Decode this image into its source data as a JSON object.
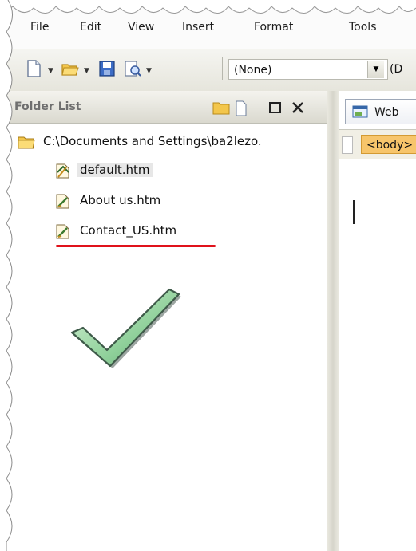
{
  "menu": {
    "items": [
      {
        "label": "File"
      },
      {
        "label": "Edit"
      },
      {
        "label": "View"
      },
      {
        "label": "Insert"
      },
      {
        "label": "Format"
      },
      {
        "label": "Tools"
      }
    ]
  },
  "toolbar": {
    "style_value": "(None)",
    "font_value": "(D"
  },
  "folder_list": {
    "title": "Folder List",
    "root_path": "C:\\Documents and Settings\\ba2lezo.",
    "files": [
      {
        "name": "default.htm",
        "selected": true
      },
      {
        "name": "About us.htm",
        "selected": false
      },
      {
        "name": "Contact_US.htm",
        "selected": false
      }
    ]
  },
  "editor": {
    "tab_label": "Web",
    "tag_label": "<body>"
  },
  "colors": {
    "underline": "#e0121b",
    "checkmark": "#9fd7a3",
    "tag_highlight": "#f7c56b"
  }
}
